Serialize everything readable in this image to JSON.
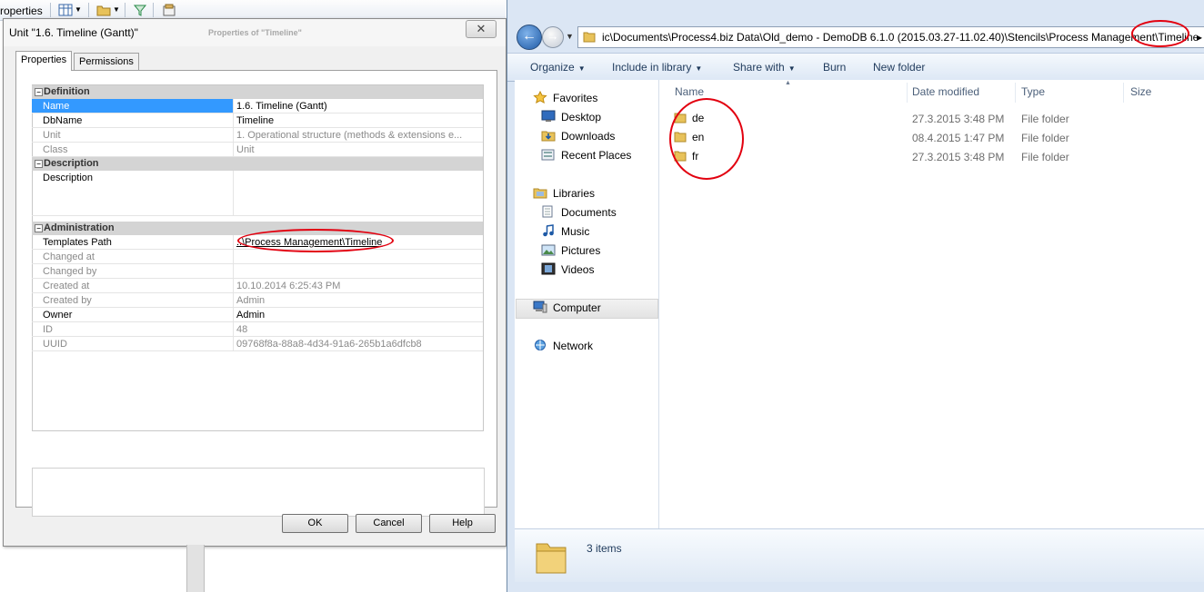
{
  "background": {
    "toolbar_label": "roperties"
  },
  "dialog": {
    "title": "Unit \"1.6. Timeline (Gantt)\"",
    "ghost_title": "Properties of \"Timeline\"",
    "close_glyph": "✕",
    "tabs": [
      "Properties",
      "Permissions"
    ],
    "sections": {
      "definition": "Definition",
      "description": "Description",
      "administration": "Administration"
    },
    "definition_rows": [
      {
        "key": "Name",
        "value": "1.6. Timeline (Gantt)"
      },
      {
        "key": "DbName",
        "value": "Timeline"
      },
      {
        "key": "Unit",
        "value": "1. Operational structure (methods & extensions e..."
      },
      {
        "key": "Class",
        "value": "Unit"
      }
    ],
    "description_rows": [
      {
        "key": "Description",
        "value": ""
      }
    ],
    "administration_rows": [
      {
        "key": "Templates Path",
        "value": "..\\Process Management\\Timeline"
      },
      {
        "key": "Changed at",
        "value": ""
      },
      {
        "key": "Changed by",
        "value": ""
      },
      {
        "key": "Created at",
        "value": "10.10.2014 6:25:43 PM"
      },
      {
        "key": "Created by",
        "value": "Admin"
      },
      {
        "key": "Owner",
        "value": "Admin"
      },
      {
        "key": "ID",
        "value": "48"
      },
      {
        "key": "UUID",
        "value": "09768f8a-88a8-4d34-91a6-265b1a6dfcb8"
      }
    ],
    "buttons": {
      "ok": "OK",
      "cancel": "Cancel",
      "help": "Help"
    }
  },
  "explorer": {
    "address_path": "ic\\Documents\\Process4.biz Data\\Old_demo - DemoDB 6.1.0 (2015.03.27-11.02.40)\\Stencils\\Process Management\\Timeline",
    "address_arrow": "▸",
    "commands": {
      "organize": "Organize",
      "include_in_library": "Include in library",
      "share_with": "Share with",
      "burn": "Burn",
      "new_folder": "New folder"
    },
    "nav": {
      "favorites": "Favorites",
      "desktop": "Desktop",
      "downloads": "Downloads",
      "recent_places": "Recent Places",
      "libraries": "Libraries",
      "documents": "Documents",
      "music": "Music",
      "pictures": "Pictures",
      "videos": "Videos",
      "computer": "Computer",
      "network": "Network"
    },
    "columns": {
      "name": "Name",
      "date_modified": "Date modified",
      "type": "Type",
      "size": "Size"
    },
    "files": [
      {
        "name": "de",
        "date": "27.3.2015 3:48 PM",
        "type": "File folder"
      },
      {
        "name": "en",
        "date": "08.4.2015 1:47 PM",
        "type": "File folder"
      },
      {
        "name": "fr",
        "date": "27.3.2015 3:48 PM",
        "type": "File folder"
      }
    ],
    "status": "3 items"
  },
  "colors": {
    "selection": "#3399ff",
    "annotation_red": "#e2000f",
    "folder_yellow": "#e8c25a"
  }
}
